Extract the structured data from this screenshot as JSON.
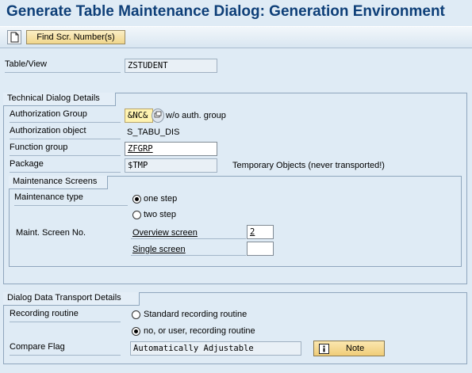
{
  "title": "Generate Table Maintenance Dialog: Generation Environment",
  "toolbar": {
    "new_icon": "document-icon",
    "find_button": "Find Scr. Number(s)"
  },
  "table_view": {
    "label": "Table/View",
    "value": "ZSTUDENT"
  },
  "technical": {
    "heading": "Technical Dialog Details",
    "auth_group_label": "Authorization Group",
    "auth_group_value": "&NC&",
    "auth_group_desc": "w/o auth. group",
    "auth_object_label": "Authorization object",
    "auth_object_value": "S_TABU_DIS",
    "function_group_label": "Function group",
    "function_group_value": "ZFGRP",
    "package_label": "Package",
    "package_value": "$TMP",
    "package_desc": "Temporary Objects (never transported!)"
  },
  "screens": {
    "heading": "Maintenance Screens",
    "type_label": "Maintenance type",
    "one_step": "one step",
    "two_step": "two step",
    "selected": "one step",
    "screen_no_label": "Maint. Screen No.",
    "overview_label": "Overview screen",
    "overview_value": "2",
    "single_label": "Single screen",
    "single_value": ""
  },
  "transport": {
    "heading": "Dialog Data Transport Details",
    "recording_label": "Recording routine",
    "standard": "Standard recording routine",
    "user": "no, or user, recording routine",
    "selected": "no, or user, recording routine",
    "compare_label": "Compare Flag",
    "compare_value": "Automatically Adjustable",
    "note_button": "Note"
  }
}
